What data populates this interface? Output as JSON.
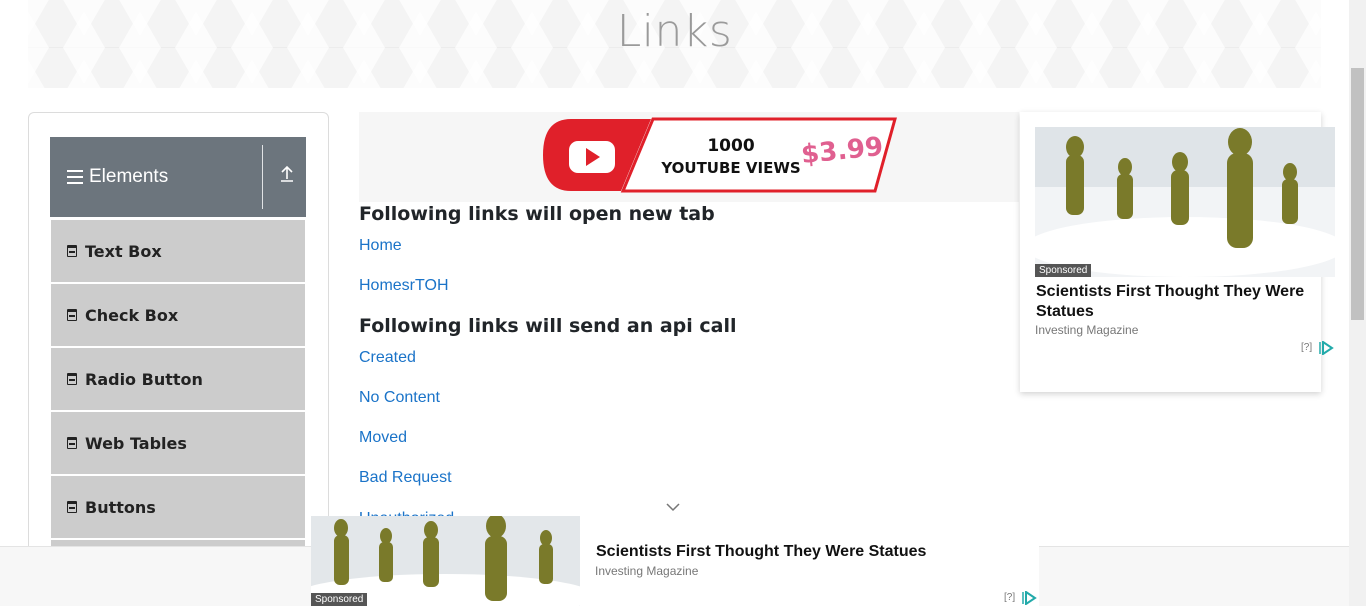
{
  "header": {
    "title": "Links"
  },
  "sidebar": {
    "group_title": "Elements",
    "items": [
      {
        "label": "Text Box"
      },
      {
        "label": "Check Box"
      },
      {
        "label": "Radio Button"
      },
      {
        "label": "Web Tables"
      },
      {
        "label": "Buttons"
      }
    ]
  },
  "ad_banner": {
    "line1": "1000",
    "line2": "YOUTUBE VIEWS",
    "price": "$3.99"
  },
  "main": {
    "section_new_tab": "Following links will open new tab",
    "new_tab_links": [
      "Home",
      "HomesrTOH"
    ],
    "section_api": "Following links will send an api call",
    "api_links": [
      "Created",
      "No Content",
      "Moved",
      "Bad Request"
    ],
    "partial_link": "Unauthorized"
  },
  "side_ad": {
    "sponsored": "Sponsored",
    "headline": "Scientists First Thought They Were Statues",
    "source": "Investing Magazine",
    "info": "[?]"
  },
  "bottom_ad": {
    "sponsored": "Sponsored",
    "headline": "Scientists First Thought They Were Statues",
    "source": "Investing Magazine",
    "info": "[?]"
  },
  "colors": {
    "link": "#1a73c8",
    "group_header": "#6c757d",
    "menu_item": "#cccccc"
  }
}
